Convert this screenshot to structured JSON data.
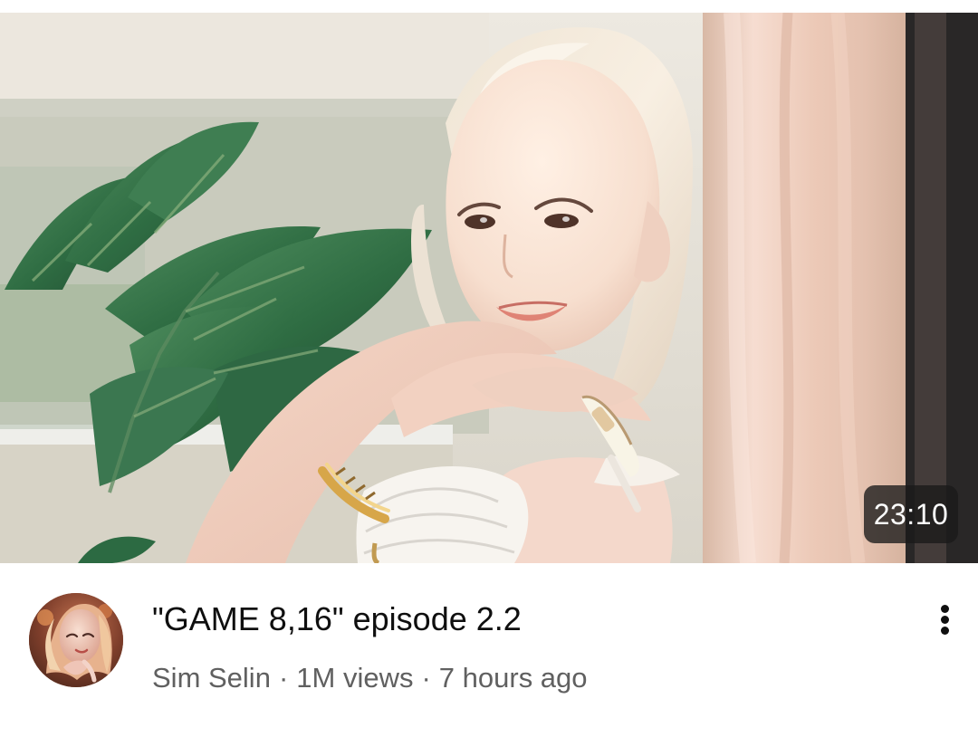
{
  "video": {
    "duration": "23:10",
    "title": "\"GAME 8,16\" episode 2.2",
    "channel": "Sim Selin",
    "views": "1M views",
    "age": "7 hours ago",
    "separator": "·"
  },
  "icons": {
    "more": "three-dot-vertical-menu-icon",
    "avatar": "channel-avatar"
  },
  "colors": {
    "title": "#0f0f0f",
    "meta": "#606060",
    "duration_badge": "#191919"
  }
}
